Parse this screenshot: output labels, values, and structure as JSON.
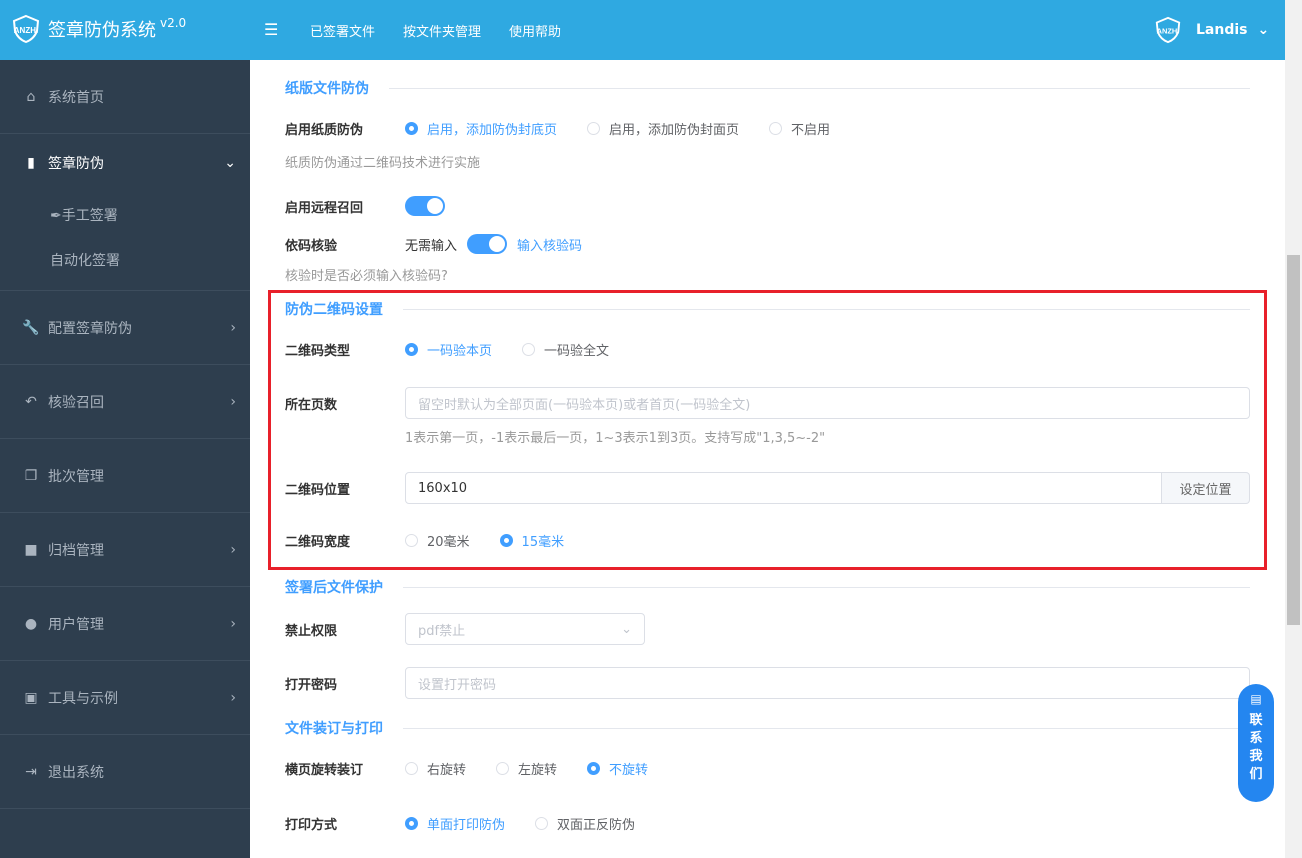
{
  "header": {
    "brand": "签章防伪系统",
    "version": "v2.0",
    "logo_text": "ANZHI",
    "nav": [
      "已签署文件",
      "按文件夹管理",
      "使用帮助"
    ],
    "user": "Landis"
  },
  "sidebar": {
    "items": [
      {
        "label": "系统首页",
        "icon": "home-icon"
      },
      {
        "label": "签章防伪",
        "icon": "file-lock-icon"
      },
      {
        "label": "配置签章防伪",
        "icon": "wrench-icon"
      },
      {
        "label": "核验召回",
        "icon": "undo-icon"
      },
      {
        "label": "批次管理",
        "icon": "copy-icon"
      },
      {
        "label": "归档管理",
        "icon": "folder-icon"
      },
      {
        "label": "用户管理",
        "icon": "users-icon"
      },
      {
        "label": "工具与示例",
        "icon": "tools-icon"
      },
      {
        "label": "退出系统",
        "icon": "logout-icon"
      }
    ],
    "sub": [
      "✒手工签署",
      "自动化签署"
    ]
  },
  "paper": {
    "title": "纸版文件防伪",
    "enable_label": "启用纸质防伪",
    "options": [
      "启用，添加防伪封底页",
      "启用，添加防伪封面页",
      "不启用"
    ],
    "selected": 0,
    "hint": "纸质防伪通过二维码技术进行实施"
  },
  "remote": {
    "label": "启用远程召回",
    "on": true
  },
  "code": {
    "label": "依码核验",
    "off_text": "无需输入",
    "on_text": "输入核验码",
    "hint": "核验时是否必须输入核验码?"
  },
  "qr": {
    "title": "防伪二维码设置",
    "type_label": "二维码类型",
    "type_options": [
      "一码验本页",
      "一码验全文"
    ],
    "type_selected": 0,
    "page_label": "所在页数",
    "page_placeholder": "留空时默认为全部页面(一码验本页)或者首页(一码验全文)",
    "page_hint": "1表示第一页，-1表示最后一页，1~3表示1到3页。支持写成\"1,3,5~-2\"",
    "pos_label": "二维码位置",
    "pos_value": "160x10",
    "pos_button": "设定位置",
    "width_label": "二维码宽度",
    "width_options": [
      "20毫米",
      "15毫米"
    ],
    "width_selected": 1
  },
  "protect": {
    "title": "签署后文件保护",
    "perm_label": "禁止权限",
    "perm_value": "pdf禁止",
    "pwd_label": "打开密码",
    "pwd_placeholder": "设置打开密码"
  },
  "print": {
    "title": "文件装订与打印",
    "rotate_label": "横页旋转装订",
    "rotate_options": [
      "右旋转",
      "左旋转",
      "不旋转"
    ],
    "rotate_selected": 2,
    "mode_label": "打印方式",
    "mode_options": [
      "单面打印防伪",
      "双面正反防伪"
    ],
    "mode_selected": 0
  },
  "contact": "联系我们"
}
